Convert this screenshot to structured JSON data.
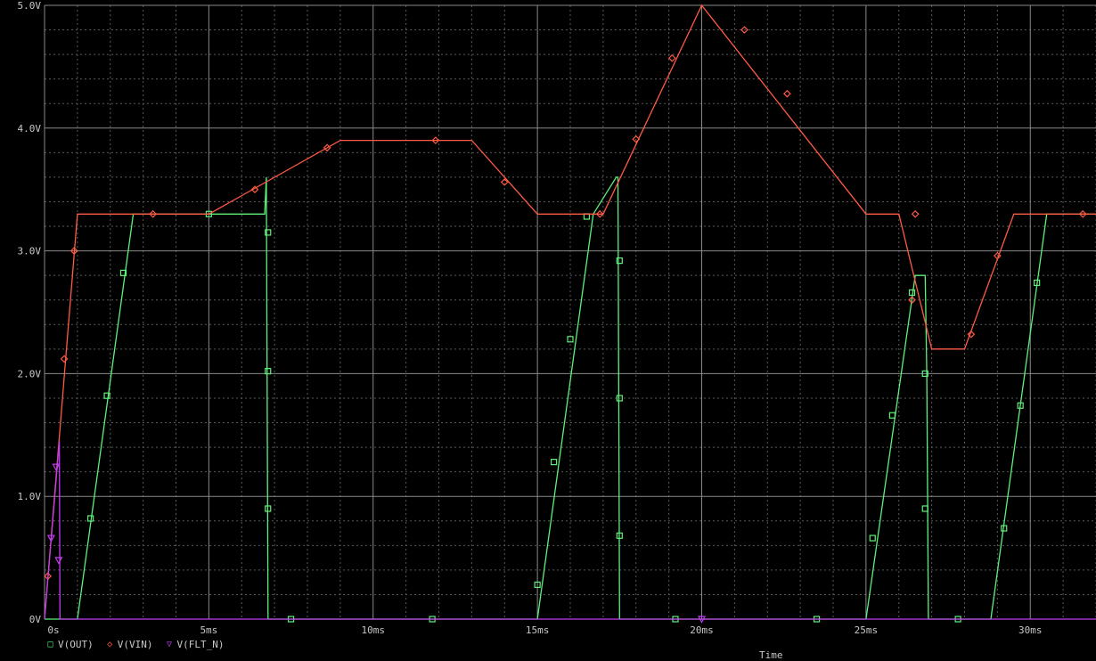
{
  "chart_data": {
    "type": "line",
    "title": "",
    "xlabel": "Time",
    "ylabel": "",
    "xlim": [
      0,
      32
    ],
    "ylim": [
      0,
      5
    ],
    "x_unit": "ms",
    "grid": true,
    "background": "#000000",
    "grid_color": "#5a5a5a",
    "y_ticks": [
      {
        "value": 0,
        "label": "0V"
      },
      {
        "value": 1,
        "label": "1.0V"
      },
      {
        "value": 2,
        "label": "2.0V"
      },
      {
        "value": 3,
        "label": "3.0V"
      },
      {
        "value": 4,
        "label": "4.0V"
      },
      {
        "value": 5,
        "label": "5.0V"
      }
    ],
    "x_ticks": [
      {
        "value": 0,
        "label": "0s"
      },
      {
        "value": 5,
        "label": "5ms"
      },
      {
        "value": 10,
        "label": "10ms"
      },
      {
        "value": 15,
        "label": "15ms"
      },
      {
        "value": 20,
        "label": "20ms"
      },
      {
        "value": 25,
        "label": "25ms"
      },
      {
        "value": 30,
        "label": "30ms"
      }
    ],
    "legend_position": "bottom-left",
    "series": [
      {
        "name": "V(OUT)",
        "color": "#5ef07a",
        "marker": "square",
        "marker_glyph": "□",
        "x": [
          0,
          1.0,
          2.7,
          6.7,
          6.75,
          6.8,
          15.0,
          16.7,
          17.4,
          17.45,
          17.5,
          25.0,
          26.5,
          26.8,
          26.85,
          26.9,
          28.8,
          30.5,
          32
        ],
        "y": [
          0,
          0,
          3.3,
          3.3,
          3.6,
          0,
          0,
          3.3,
          3.6,
          3.6,
          0,
          0,
          2.8,
          2.8,
          2.0,
          0,
          0,
          3.3,
          3.3
        ],
        "marker_x": [
          1.4,
          1.9,
          2.4,
          5.0,
          6.8,
          6.8,
          6.8,
          7.5,
          11.8,
          15.0,
          15.5,
          16.0,
          16.5,
          17.5,
          17.5,
          17.5,
          19.2,
          23.5,
          25.2,
          25.8,
          26.4,
          26.8,
          26.8,
          27.8,
          29.2,
          29.7,
          30.2
        ],
        "marker_y": [
          0.82,
          1.82,
          2.82,
          3.3,
          3.15,
          2.02,
          0.9,
          0,
          0,
          0.28,
          1.28,
          2.28,
          3.28,
          2.92,
          1.8,
          0.68,
          0,
          0,
          0.66,
          1.66,
          2.66,
          2.0,
          0.9,
          0,
          0.74,
          1.74,
          2.74
        ]
      },
      {
        "name": "V(VIN)",
        "color": "#ff5a44",
        "marker": "diamond",
        "marker_glyph": "◇",
        "x": [
          0,
          1.0,
          5.0,
          9.0,
          13.0,
          15.0,
          17.0,
          20.0,
          25.0,
          26.0,
          27.0,
          28.0,
          29.5,
          32
        ],
        "y": [
          0,
          3.3,
          3.3,
          3.9,
          3.9,
          3.3,
          3.3,
          5.0,
          3.3,
          3.3,
          2.2,
          2.2,
          3.3,
          3.3
        ],
        "marker_x": [
          0.1,
          0.6,
          0.9,
          3.3,
          6.4,
          8.6,
          11.9,
          14.0,
          16.9,
          18.0,
          19.1,
          21.3,
          22.6,
          26.4,
          26.5,
          28.2,
          29.0,
          31.6
        ],
        "marker_y": [
          0.35,
          2.12,
          3.0,
          3.3,
          3.5,
          3.84,
          3.9,
          3.56,
          3.3,
          3.91,
          4.57,
          4.8,
          4.28,
          2.6,
          3.3,
          2.32,
          2.96,
          3.3
        ]
      },
      {
        "name": "V(FLT_N)",
        "color": "#c23cf0",
        "marker": "triangle-down",
        "marker_glyph": "▽",
        "x": [
          0,
          0.45,
          0.47,
          32
        ],
        "y": [
          0,
          1.45,
          0,
          0
        ],
        "marker_x": [
          0.2,
          0.35,
          0.43,
          20.0
        ],
        "marker_y": [
          0.66,
          1.24,
          0.48,
          0
        ]
      }
    ]
  }
}
